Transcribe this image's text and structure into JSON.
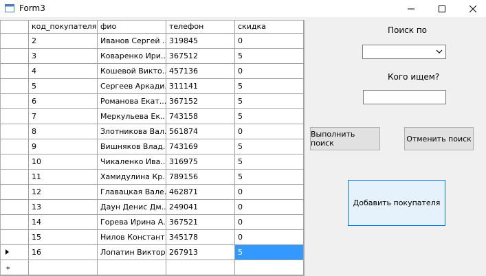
{
  "window": {
    "title": "Form3",
    "minimize_glyph": "—",
    "close_glyph": "✕"
  },
  "grid": {
    "columns": [
      "код_покупателя",
      "фио",
      "телефон",
      "скидка"
    ],
    "rows": [
      [
        "2",
        "Иванов Сергей ...",
        "319845",
        "0"
      ],
      [
        "3",
        "Коваренко Ири...",
        "367512",
        "5"
      ],
      [
        "4",
        "Кошевой Викто...",
        "457136",
        "0"
      ],
      [
        "5",
        "Сергеев Аркади...",
        "311141",
        "5"
      ],
      [
        "6",
        "Романова Екат...",
        "367152",
        "5"
      ],
      [
        "7",
        "Меркульева Ек...",
        "743158",
        "5"
      ],
      [
        "8",
        "Злотникова Вал...",
        "561874",
        "0"
      ],
      [
        "9",
        "Вишняков Влад...",
        "743169",
        "5"
      ],
      [
        "10",
        "Чикаленко Ива...",
        "316975",
        "5"
      ],
      [
        "11",
        "Хамидулина Кр...",
        "789156",
        "5"
      ],
      [
        "12",
        "Главацкая Вале...",
        "462871",
        "0"
      ],
      [
        "13",
        "Даун Денис Дм...",
        "249041",
        "0"
      ],
      [
        "14",
        "Горева Ирина А...",
        "367521",
        "0"
      ],
      [
        "15",
        "Нилов Констант...",
        "345178",
        "0"
      ],
      [
        "16",
        "Лопатин Виктор...",
        "267913",
        "5"
      ]
    ],
    "current_row_index": 14,
    "new_row_marker": "*",
    "selection_color": "#3399ff"
  },
  "search": {
    "search_by_label": "Поиск по",
    "search_by_value": "",
    "who_label": "Кого ищем?",
    "query_value": ""
  },
  "buttons": {
    "search": "Выполнить поиск",
    "cancel": "Отменить поиск",
    "add": "Добавить покупателя"
  }
}
